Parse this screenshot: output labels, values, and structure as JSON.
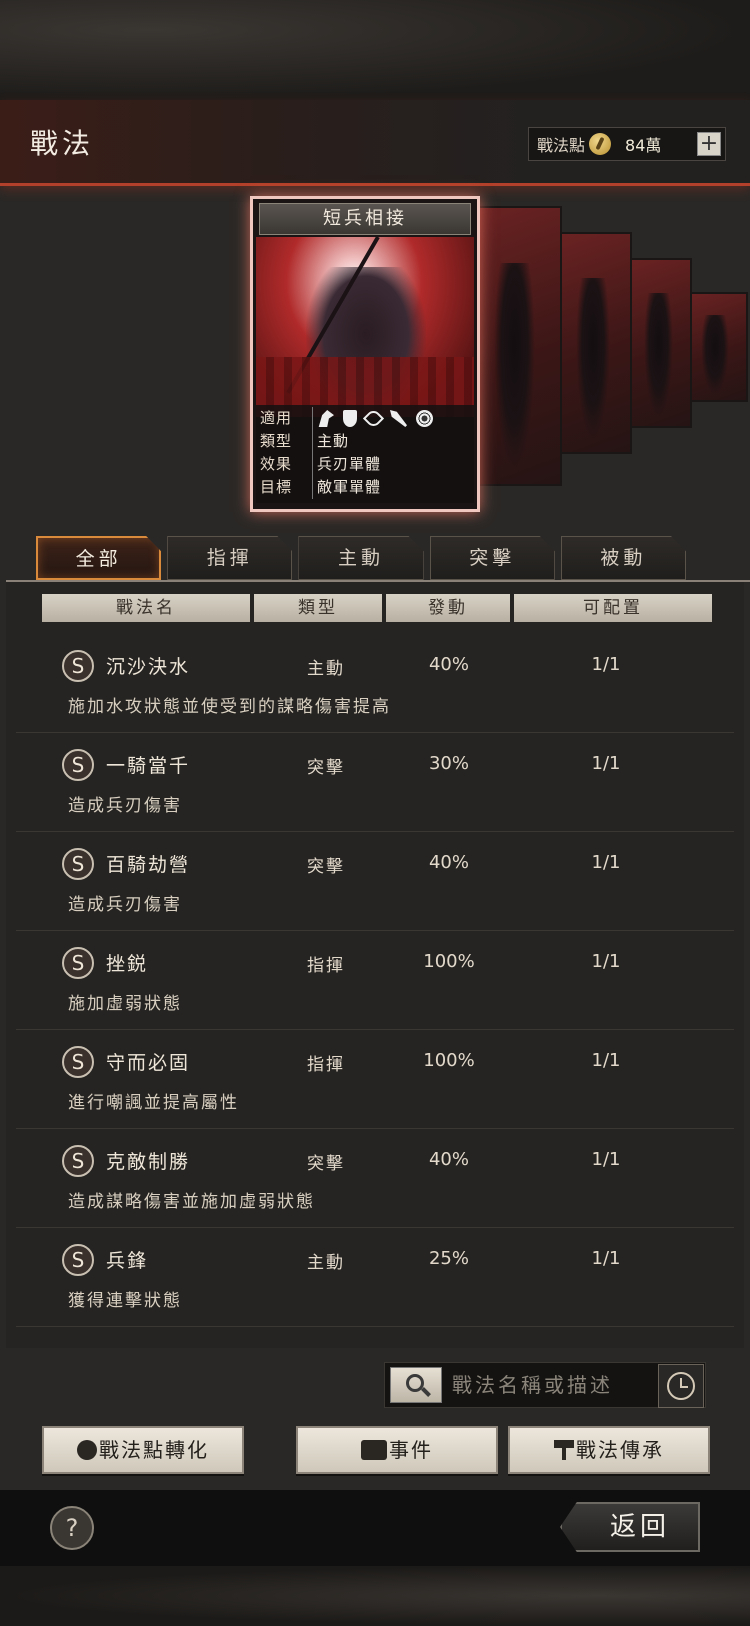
{
  "header": {
    "title": "戰法",
    "points_label": "戰法點",
    "points_value": "84萬",
    "plus_label": "+"
  },
  "card": {
    "name": "短兵相接",
    "applicable_label": "適用",
    "type_label": "類型",
    "type_value": "主動",
    "effect_label": "效果",
    "effect_value": "兵刃單體",
    "target_label": "目標",
    "target_value": "敵軍單體",
    "applicable_icons": [
      "cavalry-icon",
      "shield-icon",
      "bow-icon",
      "spear-icon",
      "chariot-icon"
    ]
  },
  "tabs": [
    {
      "label": "全部",
      "active": true
    },
    {
      "label": "指揮",
      "active": false
    },
    {
      "label": "主動",
      "active": false
    },
    {
      "label": "突擊",
      "active": false
    },
    {
      "label": "被動",
      "active": false
    }
  ],
  "columns": [
    "戰法名",
    "類型",
    "發動",
    "可配置"
  ],
  "tactics": [
    {
      "grade": "S",
      "name": "沉沙決水",
      "type": "主動",
      "rate": "40%",
      "capacity": "1/1",
      "desc": "施加水攻狀態並使受到的謀略傷害提高"
    },
    {
      "grade": "S",
      "name": "一騎當千",
      "type": "突擊",
      "rate": "30%",
      "capacity": "1/1",
      "desc": "造成兵刃傷害"
    },
    {
      "grade": "S",
      "name": "百騎劫營",
      "type": "突擊",
      "rate": "40%",
      "capacity": "1/1",
      "desc": "造成兵刃傷害"
    },
    {
      "grade": "S",
      "name": "挫鋭",
      "type": "指揮",
      "rate": "100%",
      "capacity": "1/1",
      "desc": "施加虛弱狀態"
    },
    {
      "grade": "S",
      "name": "守而必固",
      "type": "指揮",
      "rate": "100%",
      "capacity": "1/1",
      "desc": "進行嘲諷並提高屬性"
    },
    {
      "grade": "S",
      "name": "克敵制勝",
      "type": "突擊",
      "rate": "40%",
      "capacity": "1/1",
      "desc": "造成謀略傷害並施加虛弱狀態"
    },
    {
      "grade": "S",
      "name": "兵鋒",
      "type": "主動",
      "rate": "25%",
      "capacity": "1/1",
      "desc": "獲得連擊狀態"
    }
  ],
  "search": {
    "placeholder": "戰法名稱或描述"
  },
  "actions": {
    "convert_label": "戰法點轉化",
    "event_label": "事件",
    "inherit_label": "戰法傳承"
  },
  "footer": {
    "help_label": "?",
    "back_label": "返回"
  }
}
